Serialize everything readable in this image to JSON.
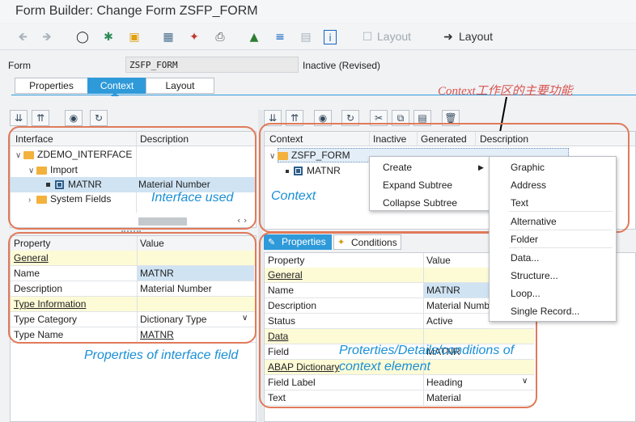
{
  "window": {
    "title": "Form Builder: Change Form ZSFP_FORM"
  },
  "toolbar": {
    "icons": [
      "arrow-left-icon",
      "arrow-right-icon",
      "glasses-icon",
      "activate-icon",
      "check-icon",
      "hierarchy-icon",
      "wand-icon",
      "print-icon",
      "tree-icon",
      "align-icon",
      "form-icon",
      "info-icon"
    ],
    "layout_inactive_label": "Layout",
    "layout_active_label": "Layout"
  },
  "form": {
    "label": "Form",
    "value": "ZSFP_FORM",
    "status": "Inactive (Revised)"
  },
  "tabs": [
    {
      "label": "Properties"
    },
    {
      "label": "Context"
    },
    {
      "label": "Layout"
    }
  ],
  "interface_tree": {
    "columns": [
      "Interface",
      "Description"
    ],
    "nodes": [
      {
        "label": "ZDEMO_INTERFACE",
        "desc": ""
      },
      {
        "label": "Import",
        "desc": ""
      },
      {
        "label": "MATNR",
        "desc": "Material Number"
      },
      {
        "label": "System Fields",
        "desc": ""
      }
    ]
  },
  "context_tree": {
    "columns": [
      "Context",
      "Inactive",
      "Generated",
      "Description"
    ],
    "nodes": [
      {
        "label": "ZSFP_FORM"
      },
      {
        "label": "MATNR"
      }
    ]
  },
  "context_menu": {
    "items": [
      "Create",
      "Expand Subtree",
      "Collapse Subtree"
    ]
  },
  "create_submenu": {
    "items": [
      "Graphic",
      "Address",
      "Text",
      "Alternative",
      "Folder",
      "Data...",
      "Structure...",
      "Loop...",
      "Single Record..."
    ]
  },
  "left_props": {
    "columns": [
      "Property",
      "Value"
    ],
    "rows": [
      {
        "type": "section",
        "label": "General"
      },
      {
        "label": "Name",
        "value": "MATNR"
      },
      {
        "label": "Description",
        "value": "Material Number"
      },
      {
        "type": "section",
        "label": "Type Information"
      },
      {
        "label": "Type Category",
        "value": "Dictionary Type"
      },
      {
        "label": "Type Name",
        "value": "MATNR"
      }
    ]
  },
  "right_tabs": [
    {
      "label": "Properties"
    },
    {
      "label": "Conditions"
    }
  ],
  "right_props": {
    "columns": [
      "Property",
      "Value"
    ],
    "rows": [
      {
        "type": "section",
        "label": "General"
      },
      {
        "label": "Name",
        "value": "MATNR"
      },
      {
        "label": "Description",
        "value": "Material Numb"
      },
      {
        "label": "Status",
        "value": "Active"
      },
      {
        "type": "section",
        "label": "Data"
      },
      {
        "label": "Field",
        "value": "MATNR"
      },
      {
        "type": "section",
        "label": "ABAP Dictionary"
      },
      {
        "label": "Field Label",
        "value": "Heading"
      },
      {
        "label": "Text",
        "value": "Material"
      }
    ]
  },
  "annotations": {
    "context_work_area": "Context工作区的主要功能",
    "interface_used": "Interface used",
    "context": "Context",
    "props_interface_field": "Properties of interface field",
    "props_context_element": "Proterties/Details/conditions of context element"
  },
  "colors": {
    "accent": "#2f9ad9",
    "annotation_border": "#e07a5a",
    "annotation_text": "#1a8fd6",
    "section_bg": "#fdfbd6"
  }
}
